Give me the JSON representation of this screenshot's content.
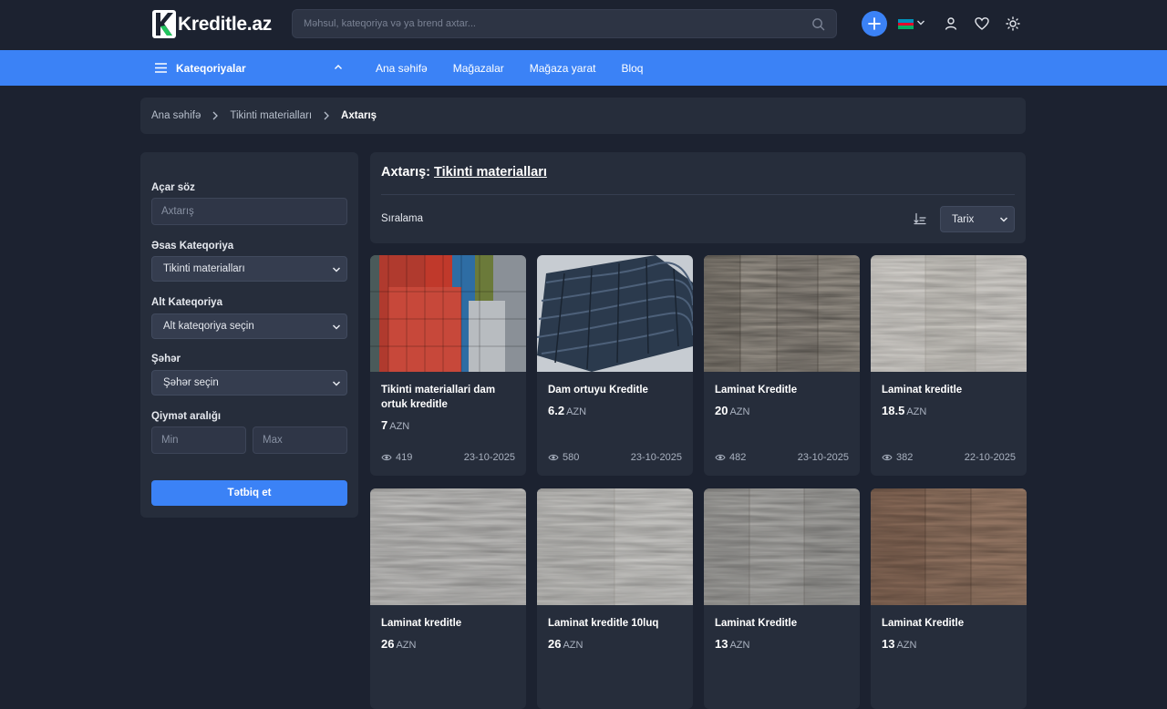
{
  "header": {
    "logo_text": "Kreditle.az",
    "search_placeholder": "Məhsul, kateqoriya və ya brend axtar...",
    "flag_colors": [
      "#0092bc",
      "#e4002b",
      "#00af66"
    ]
  },
  "nav": {
    "categories_label": "Kateqoriyalar",
    "links": [
      "Ana səhifə",
      "Mağazalar",
      "Mağaza yarat",
      "Bloq"
    ]
  },
  "breadcrumb": [
    "Ana səhifə",
    "Tikinti materialları",
    "Axtarış"
  ],
  "filters": {
    "keyword_label": "Açar söz",
    "keyword_placeholder": "Axtarış",
    "main_cat_label": "Əsas Kateqoriya",
    "main_cat_value": "Tikinti materialları",
    "sub_cat_label": "Alt Kateqoriya",
    "sub_cat_value": "Alt kateqoriya seçin",
    "city_label": "Şəhər",
    "city_value": "Şəhər seçin",
    "price_label": "Qiymət aralığı",
    "min_placeholder": "Min",
    "max_placeholder": "Max",
    "apply_label": "Tətbiq et"
  },
  "results": {
    "title_prefix": "Axtarış: ",
    "title_link": "Tikinti materialları",
    "sort_label": "Sıralama",
    "sort_value": "Tarix"
  },
  "products": [
    {
      "title": "Tikinti materiallari dam ortuk kreditle",
      "price": "7",
      "currency": "AZN",
      "views": "419",
      "date": "23-10-2025"
    },
    {
      "title": "Dam ortuyu Kreditle",
      "price": "6.2",
      "currency": "AZN",
      "views": "580",
      "date": "23-10-2025"
    },
    {
      "title": "Laminat Kreditle",
      "price": "20",
      "currency": "AZN",
      "views": "482",
      "date": "23-10-2025"
    },
    {
      "title": "Laminat kreditle",
      "price": "18.5",
      "currency": "AZN",
      "views": "382",
      "date": "22-10-2025"
    },
    {
      "title": "Laminat kreditle",
      "price": "26",
      "currency": "AZN",
      "views": "",
      "date": ""
    },
    {
      "title": "Laminat kreditle 10luq",
      "price": "26",
      "currency": "AZN",
      "views": "",
      "date": ""
    },
    {
      "title": "Laminat Kreditle",
      "price": "13",
      "currency": "AZN",
      "views": "",
      "date": ""
    },
    {
      "title": "Laminat Kreditle",
      "price": "13",
      "currency": "AZN",
      "views": "",
      "date": ""
    }
  ]
}
